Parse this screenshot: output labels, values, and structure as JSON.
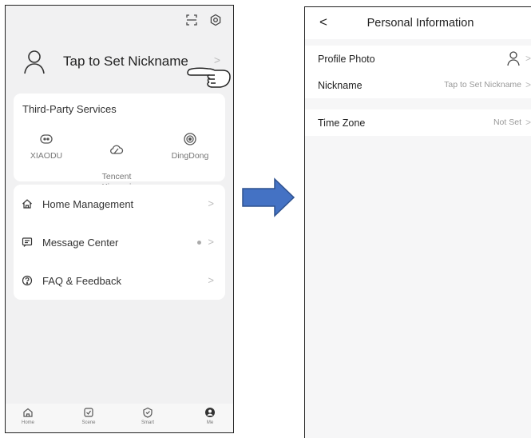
{
  "left_screen": {
    "nickname_prompt": "Tap to Set Nickname",
    "chevron": ">",
    "third_party": {
      "title": "Third-Party Services",
      "services": [
        {
          "label": "XIAODU",
          "icon": "xiaodu-icon"
        },
        {
          "label": "Tencent\nXiaowei",
          "icon": "tencent-xiaowei-icon"
        },
        {
          "label": "DingDong",
          "icon": "dingdong-icon"
        }
      ]
    },
    "menu": [
      {
        "label": "Home Management",
        "icon": "home-icon"
      },
      {
        "label": "Message Center",
        "icon": "message-icon"
      },
      {
        "label": "FAQ & Feedback",
        "icon": "help-icon"
      }
    ],
    "tabs": [
      {
        "label": "Home",
        "icon": "home-tab-icon"
      },
      {
        "label": "Scene",
        "icon": "scene-tab-icon"
      },
      {
        "label": "Smart",
        "icon": "smart-tab-icon"
      },
      {
        "label": "Me",
        "icon": "me-tab-icon"
      }
    ],
    "top_icons": [
      "scan-icon",
      "settings-icon"
    ]
  },
  "right_screen": {
    "back": "<",
    "title": "Personal Information",
    "rows": [
      {
        "label": "Profile Photo",
        "value": ""
      },
      {
        "label": "Nickname",
        "value": "Tap to Set Nickname"
      },
      {
        "label": "Time Zone",
        "value": "Not Set"
      }
    ],
    "chevron": ">"
  },
  "colors": {
    "arrow_fill": "#4472c4",
    "arrow_stroke": "#2f528f",
    "screen_bg": "#f1f1f2",
    "card_bg": "#ffffff"
  }
}
